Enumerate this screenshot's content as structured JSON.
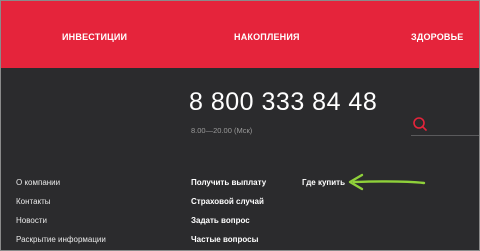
{
  "nav": {
    "items": [
      {
        "label": "ИНВЕСТИЦИИ"
      },
      {
        "label": "НАКОПЛЕНИЯ"
      },
      {
        "label": "ЗДОРОВЬЕ"
      }
    ]
  },
  "contact": {
    "phone": "8 800 333 84 48",
    "hours": "8.00—20.00 (Мск)"
  },
  "search": {
    "icon": "search-icon"
  },
  "footer": {
    "col1": [
      "О компании",
      "Контакты",
      "Новости",
      "Раскрытие информации"
    ],
    "col2": [
      "Получить выплату",
      "Страховой случай",
      "Задать вопрос",
      "Частые вопросы"
    ],
    "col3": [
      "Где купить"
    ]
  },
  "colors": {
    "brand_red": "#e5243b",
    "background": "#2b2b2d",
    "arrow_green": "#8fd13a"
  }
}
